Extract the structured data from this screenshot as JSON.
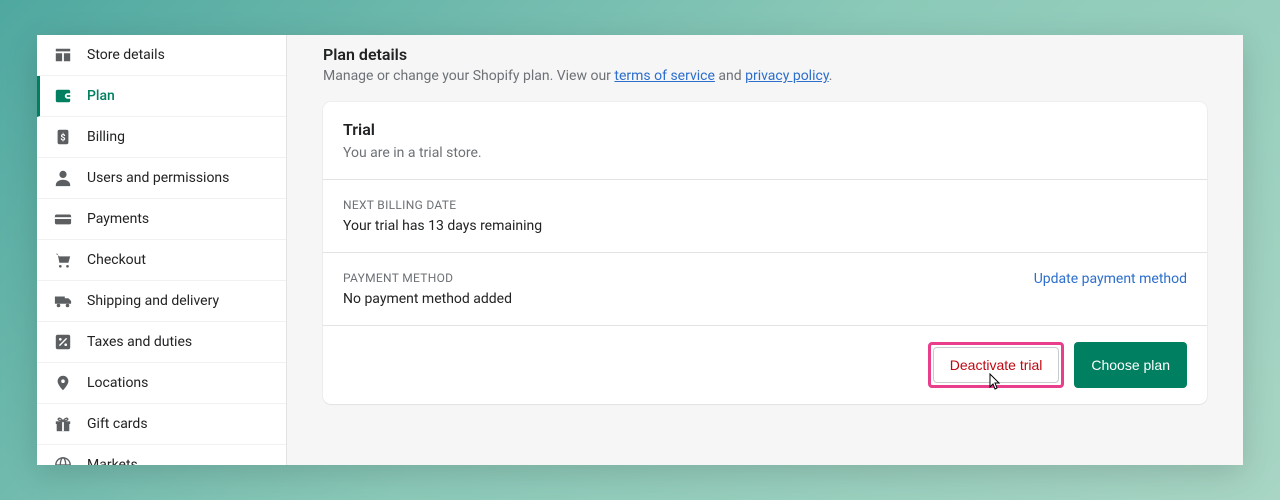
{
  "sidebar": {
    "items": [
      {
        "label": "Store details",
        "icon": "store"
      },
      {
        "label": "Plan",
        "icon": "wallet",
        "active": true
      },
      {
        "label": "Billing",
        "icon": "dollar"
      },
      {
        "label": "Users and permissions",
        "icon": "user"
      },
      {
        "label": "Payments",
        "icon": "card"
      },
      {
        "label": "Checkout",
        "icon": "cart"
      },
      {
        "label": "Shipping and delivery",
        "icon": "truck"
      },
      {
        "label": "Taxes and duties",
        "icon": "percent"
      },
      {
        "label": "Locations",
        "icon": "pin"
      },
      {
        "label": "Gift cards",
        "icon": "gift"
      },
      {
        "label": "Markets",
        "icon": "globe"
      }
    ]
  },
  "main": {
    "title": "Plan details",
    "subtitle_prefix": "Manage or change your Shopify plan. View our ",
    "tos_link": "terms of service",
    "subtitle_and": " and ",
    "privacy_link": "privacy policy",
    "subtitle_suffix": ".",
    "trial": {
      "title": "Trial",
      "subtitle": "You are in a trial store."
    },
    "billing": {
      "label": "NEXT BILLING DATE",
      "text": "Your trial has 13 days remaining"
    },
    "payment": {
      "label": "PAYMENT METHOD",
      "text": "No payment method added",
      "update_link": "Update payment method"
    },
    "actions": {
      "deactivate": "Deactivate trial",
      "choose": "Choose plan"
    }
  }
}
